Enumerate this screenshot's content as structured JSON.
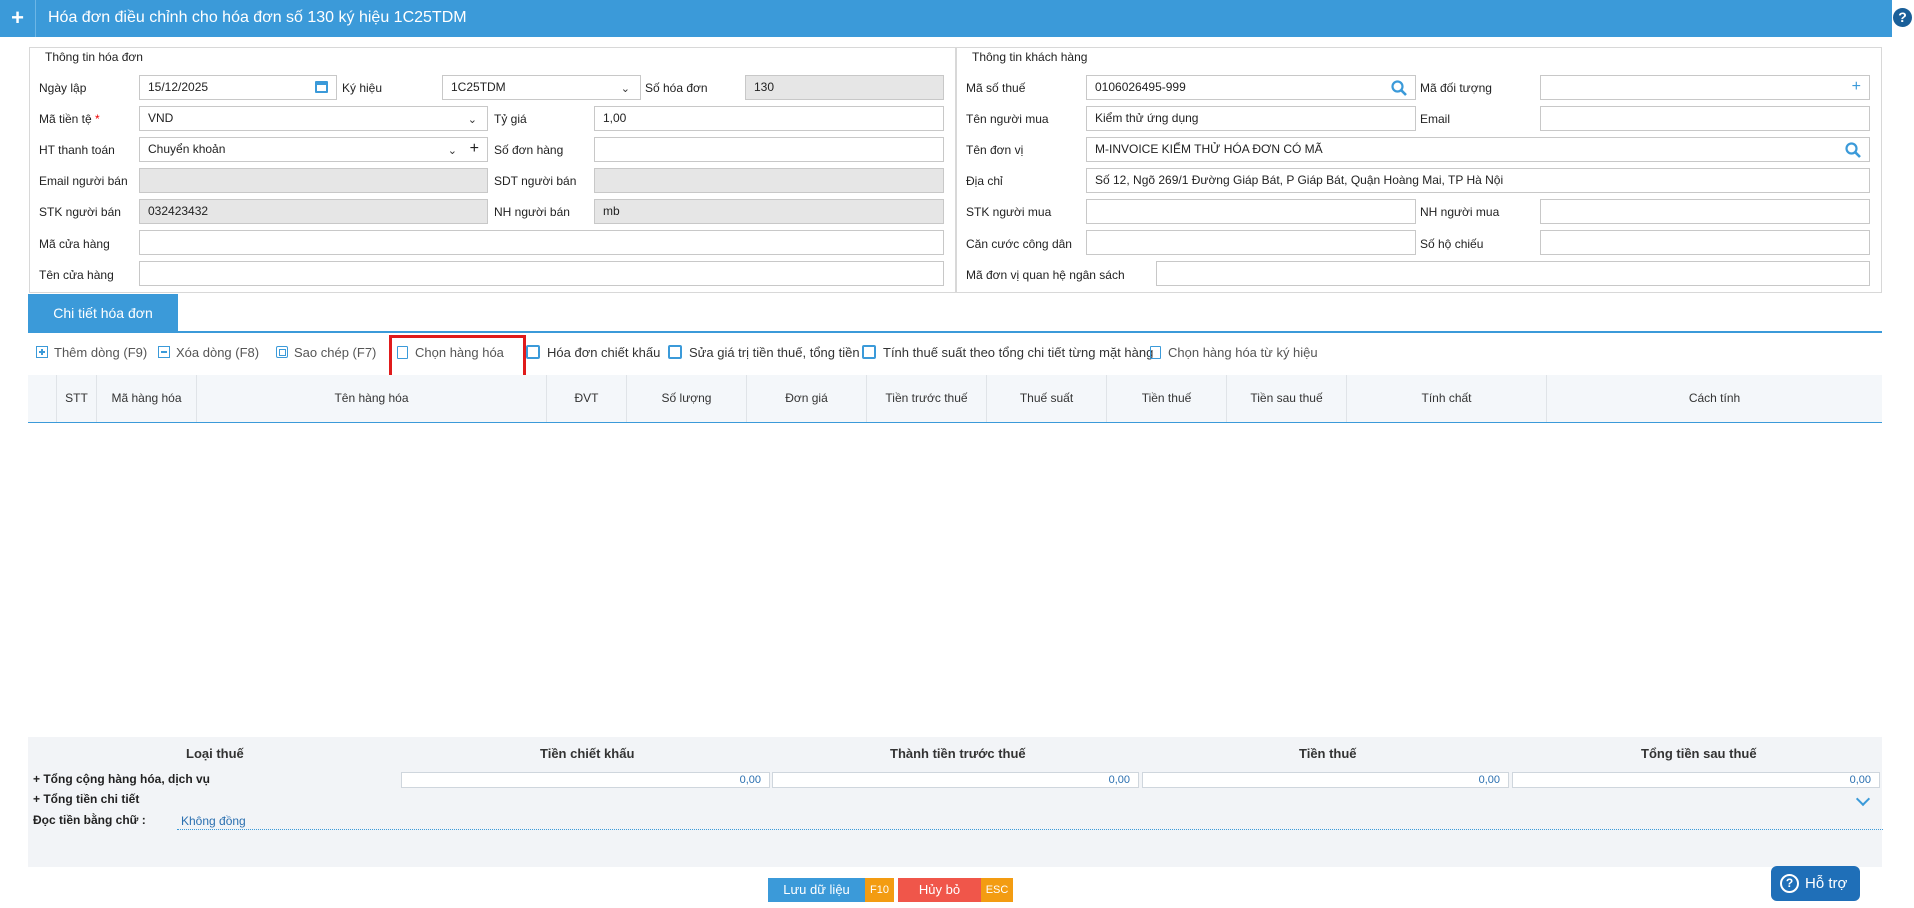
{
  "window": {
    "title": "Hóa đơn điều chỉnh cho hóa đơn số 130 ký hiệu 1C25TDM",
    "help_glyph": "?"
  },
  "invoice_info": {
    "legend": "Thông tin hóa đơn",
    "ngay_lap": {
      "label": "Ngày lập",
      "value": "15/12/2025"
    },
    "ky_hieu": {
      "label": "Ký hiệu",
      "value": "1C25TDM"
    },
    "so_hoa_don": {
      "label": "Số hóa đơn",
      "value": "130"
    },
    "ma_tien_te": {
      "label": "Mã tiền tệ",
      "required_mark": "*",
      "value": "VND"
    },
    "ty_gia": {
      "label": "Tỷ giá",
      "value": "1,00"
    },
    "ht_thanh_toan": {
      "label": "HT thanh toán",
      "value": "Chuyển khoản"
    },
    "so_don_hang": {
      "label": "Số đơn hàng",
      "value": ""
    },
    "email_nguoi_ban": {
      "label": "Email người bán",
      "value": ""
    },
    "sdt_nguoi_ban": {
      "label": "SDT người bán",
      "value": ""
    },
    "stk_nguoi_ban": {
      "label": "STK người bán",
      "value": "032423432"
    },
    "nh_nguoi_ban": {
      "label": "NH người bán",
      "value": "mb"
    },
    "ma_cua_hang": {
      "label": "Mã cửa hàng",
      "value": ""
    },
    "ten_cua_hang": {
      "label": "Tên cửa hàng",
      "value": ""
    }
  },
  "customer_info": {
    "legend": "Thông tin khách hàng",
    "ma_so_thue": {
      "label": "Mã số thuế",
      "value": "0106026495-999"
    },
    "ma_doi_tuong": {
      "label": "Mã đối tượng",
      "value": ""
    },
    "ten_nguoi_mua": {
      "label": "Tên người mua",
      "value": "Kiểm thử ứng dụng"
    },
    "email": {
      "label": "Email",
      "value": ""
    },
    "ten_don_vi": {
      "label": "Tên đơn vị",
      "value": "M-INVOICE KIỂM THỬ HÓA ĐƠN CÓ MÃ"
    },
    "dia_chi": {
      "label": "Địa chỉ",
      "value": "Số 12, Ngõ 269/1 Đường Giáp Bát, P Giáp Bát, Quận Hoàng Mai, TP Hà Nội"
    },
    "stk_nguoi_mua": {
      "label": "STK người mua",
      "value": ""
    },
    "nh_nguoi_mua": {
      "label": "NH người mua",
      "value": ""
    },
    "can_cuoc": {
      "label": "Căn cước công dân",
      "value": ""
    },
    "so_ho_chieu": {
      "label": "Số hộ chiếu",
      "value": ""
    },
    "ma_dv_qhns": {
      "label": "Mã đơn vị quan hệ ngân sách",
      "value": ""
    }
  },
  "tab": {
    "label": "Chi tiết hóa đơn"
  },
  "toolbar": {
    "add_row": "Thêm dòng (F9)",
    "delete_row": "Xóa dòng (F8)",
    "copy": "Sao chép (F7)",
    "choose_goods": "Chọn hàng hóa",
    "discount_invoice": "Hóa đơn chiết khấu",
    "edit_tax_values": "Sửa giá trị tiền thuế, tổng tiền",
    "calc_tax_rate": "Tính thuế suất theo tổng chi tiết từng mặt hàng",
    "choose_goods_from_symbol": "Chọn hàng hóa từ ký hiệu"
  },
  "grid": {
    "columns": [
      "STT",
      "Mã hàng hóa",
      "Tên hàng hóa",
      "ĐVT",
      "Số lượng",
      "Đơn giá",
      "Tiền trước thuế",
      "Thuế suất",
      "Tiền thuế",
      "Tiền sau thuế",
      "Tính chất",
      "Cách tính"
    ]
  },
  "summary": {
    "headers": [
      "Loại thuế",
      "Tiền chiết khấu",
      "Thành tiền trước thuế",
      "Tiền thuế",
      "Tổng tiền sau thuế"
    ],
    "row_total_goods": "+ Tổng cộng hàng hóa, dịch vụ",
    "row_total_detail": "+ Tổng tiền chi tiết",
    "values": [
      "0,00",
      "0,00",
      "0,00",
      "0,00"
    ],
    "read_label": "Đọc tiền bằng chữ :",
    "read_value": "Không đồng"
  },
  "buttons": {
    "save": "Lưu dữ liệu",
    "save_key": "F10",
    "cancel": "Hủy bỏ",
    "cancel_key": "ESC"
  },
  "support": {
    "label": "Hỗ trợ",
    "glyph": "?"
  }
}
